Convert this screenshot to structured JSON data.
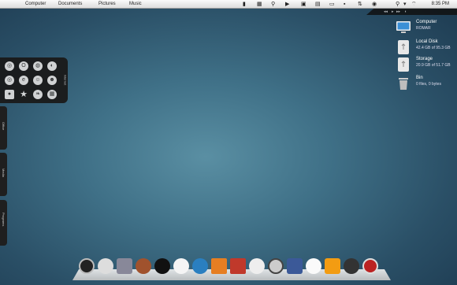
{
  "menubar": {
    "items": [
      "Computer",
      "Documents",
      "Pictures",
      "Music"
    ],
    "clock": "8:35 PM"
  },
  "drives": [
    {
      "name": "Computer",
      "sub": "ROMAR",
      "icon": "monitor-icon"
    },
    {
      "name": "Local Disk",
      "sub": "42.4 GB of 95.3 GB",
      "icon": "usb-drive-icon"
    },
    {
      "name": "Storage",
      "sub": "20.9 GB of 51.7 GB",
      "icon": "usb-drive-icon"
    },
    {
      "name": "Bin",
      "sub": "0 files, 0 bytes",
      "icon": "trash-bin-icon"
    }
  ],
  "launcher": {
    "tab_label": "Internet",
    "icons": [
      "chrome-icon",
      "opera-icon",
      "firefox-icon",
      "browser-icon",
      "chrome-icon",
      "ie-icon",
      "messenger-icon",
      "contacts-icon",
      "user-icon",
      "star-icon",
      "leaf-icon",
      "grid-icon"
    ]
  },
  "side_tabs": [
    "Office",
    "Media",
    "Programs"
  ],
  "dock": {
    "icons": [
      "power-icon",
      "sync-icon",
      "tools-icon",
      "character-icon",
      "yinyang-icon",
      "ghost-icon",
      "globe-icon",
      "folder-icon",
      "cup-icon",
      "panda-icon",
      "browser-icon",
      "facebook-icon",
      "ghost-icon",
      "rss-icon",
      "camera-icon",
      "pokeball-icon"
    ]
  },
  "colors": {
    "wallpaper_center": "#5a8fa3",
    "wallpaper_edge": "#1d3a50",
    "panel": "#1a1a1a"
  }
}
